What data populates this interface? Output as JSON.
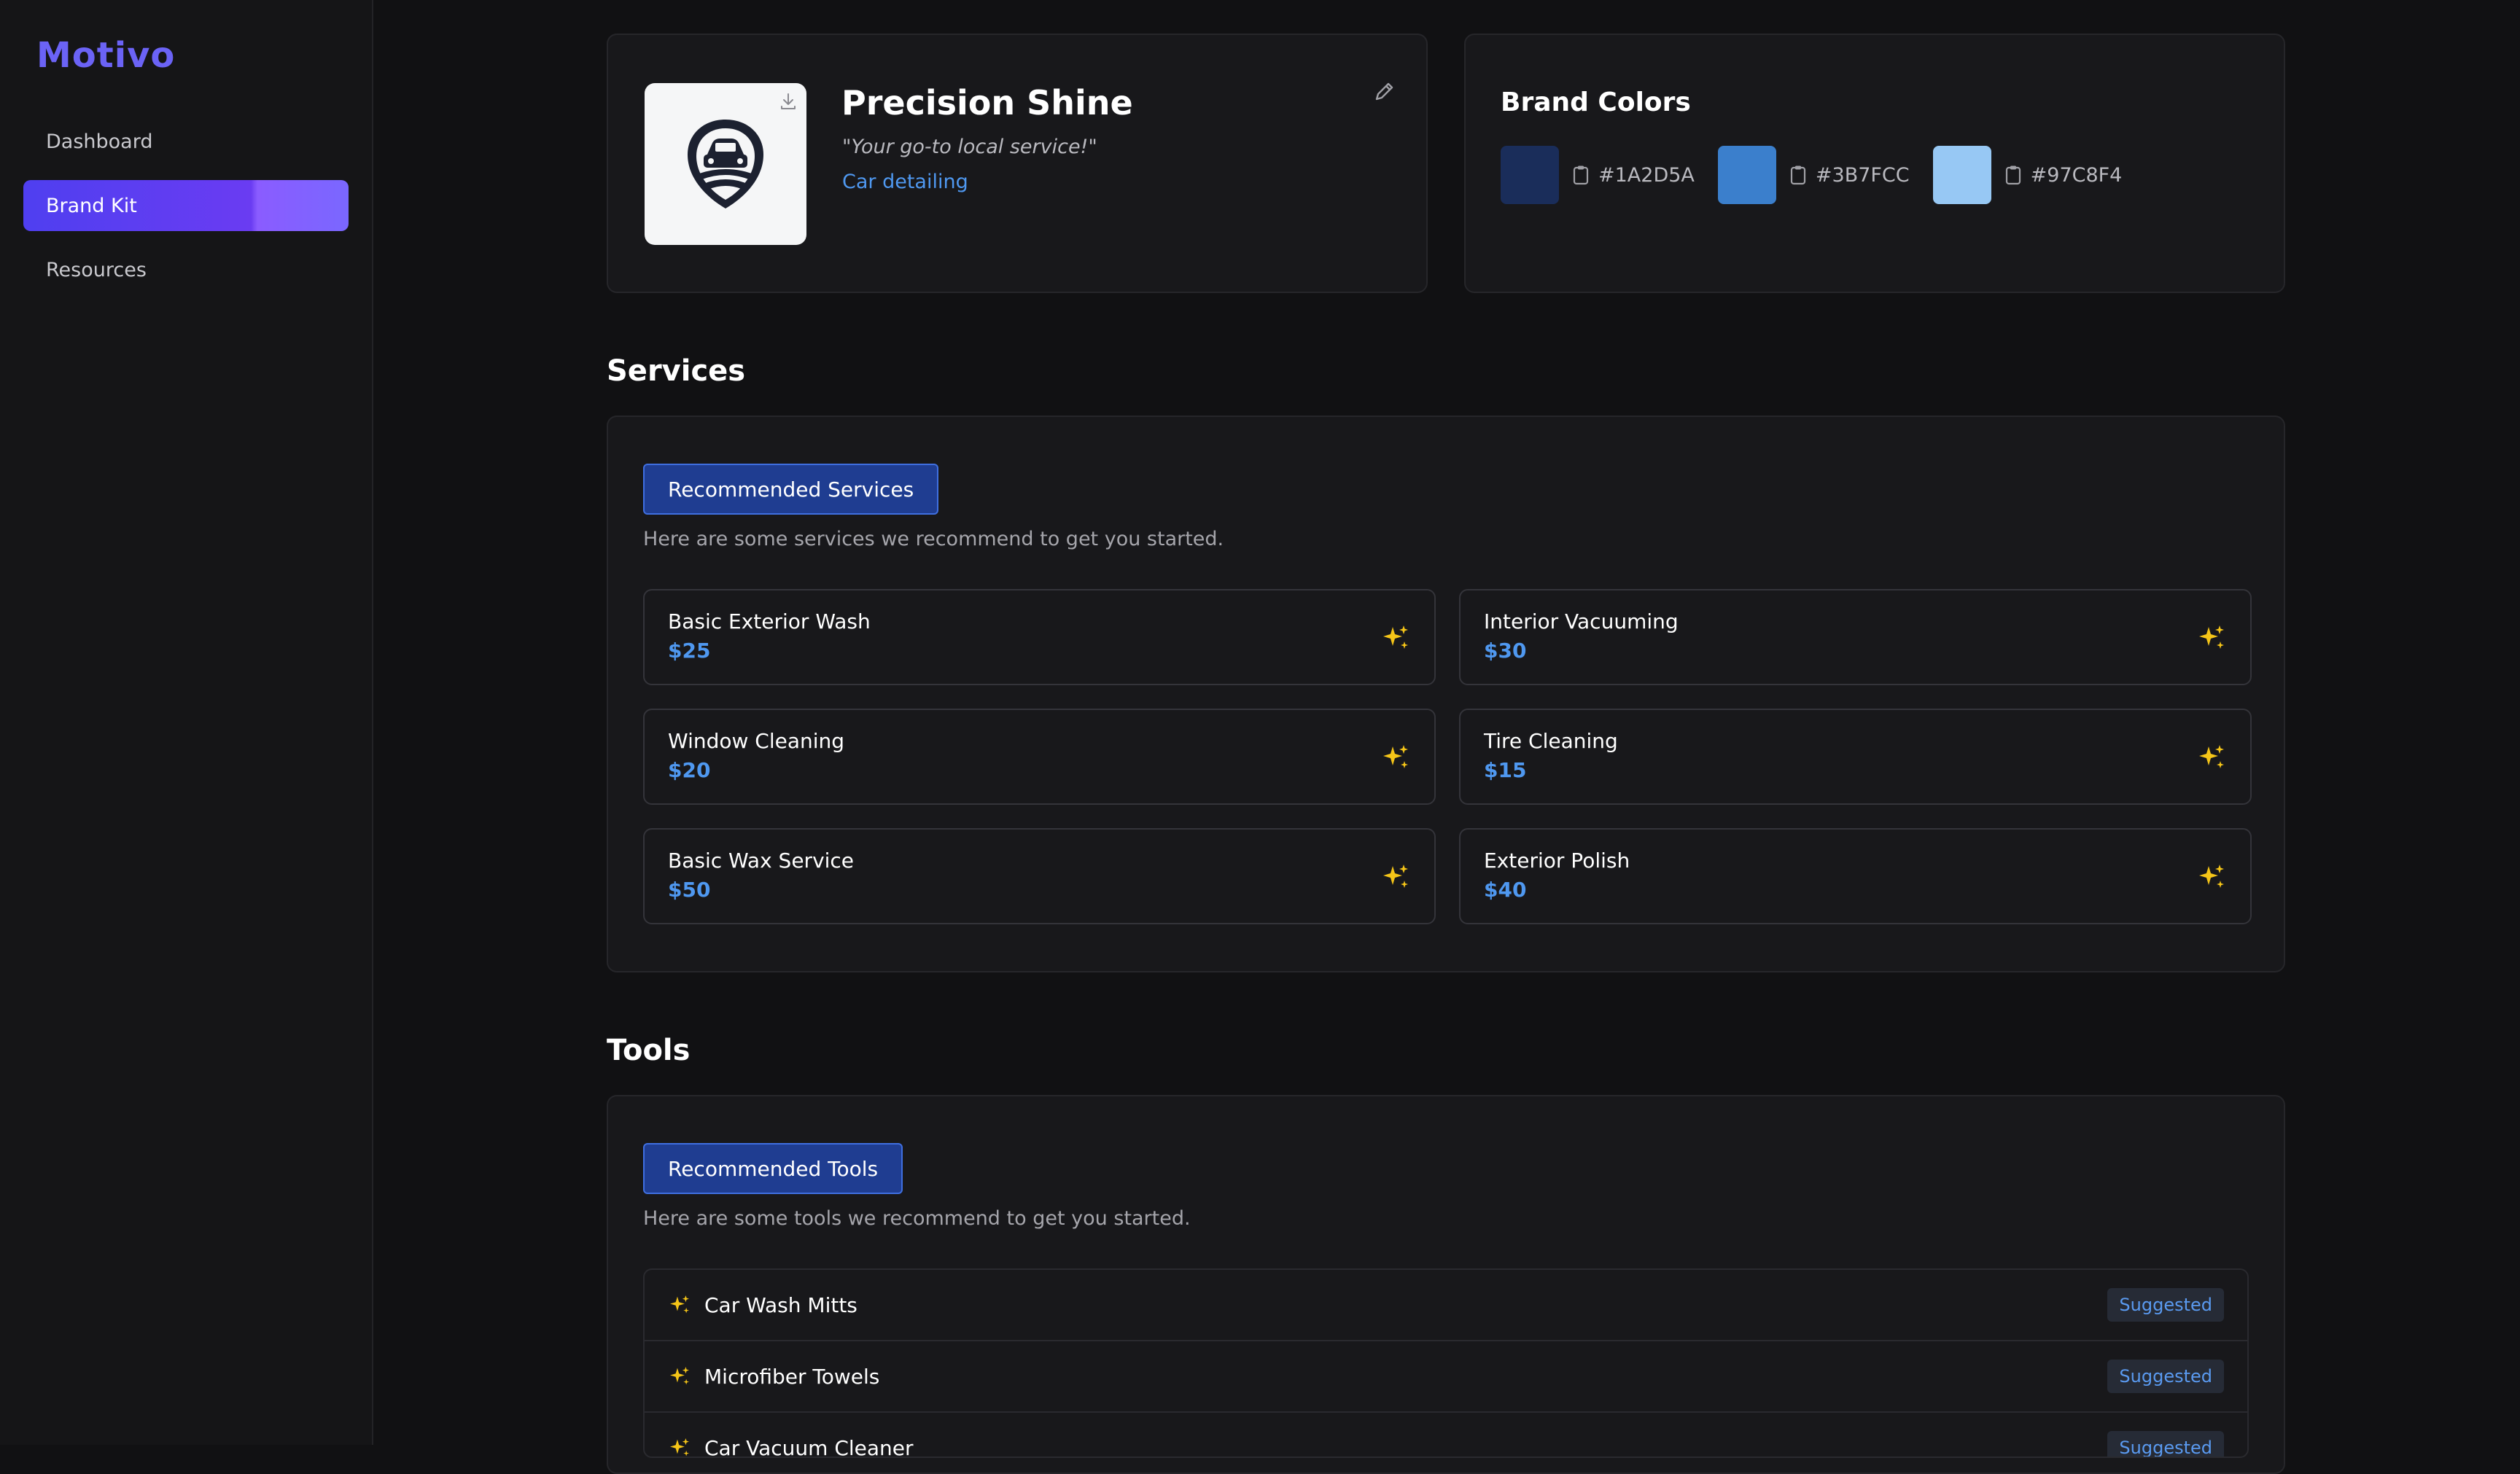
{
  "app": {
    "name": "Motivo"
  },
  "sidebar": {
    "items": [
      {
        "label": "Dashboard"
      },
      {
        "label": "Brand Kit",
        "active": true
      },
      {
        "label": "Resources"
      }
    ]
  },
  "brand": {
    "name": "Precision Shine",
    "tagline": "\"Your go-to local service!\"",
    "category": "Car detailing",
    "logo_icon": "car-shield-logo",
    "download_icon": "download-icon",
    "edit_icon": "pencil-icon"
  },
  "brand_colors": {
    "title": "Brand Colors",
    "colors": [
      {
        "hex": "#1A2D5A",
        "label": "#1A2D5A"
      },
      {
        "hex": "#3B7FCC",
        "label": "#3B7FCC"
      },
      {
        "hex": "#97C8F4",
        "label": "#97C8F4"
      }
    ]
  },
  "services": {
    "title": "Services",
    "pill": "Recommended Services",
    "subtitle": "Here are some services we recommend to get you started.",
    "items": [
      {
        "name": "Basic Exterior Wash",
        "price": "$25"
      },
      {
        "name": "Interior Vacuuming",
        "price": "$30"
      },
      {
        "name": "Window Cleaning",
        "price": "$20"
      },
      {
        "name": "Tire Cleaning",
        "price": "$15"
      },
      {
        "name": "Basic Wax Service",
        "price": "$50"
      },
      {
        "name": "Exterior Polish",
        "price": "$40"
      }
    ]
  },
  "tools": {
    "title": "Tools",
    "pill": "Recommended Tools",
    "subtitle": "Here are some tools we recommend to get you started.",
    "items": [
      {
        "name": "Car Wash Mitts",
        "badge": "Suggested"
      },
      {
        "name": "Microfiber Towels",
        "badge": "Suggested"
      },
      {
        "name": "Car Vacuum Cleaner",
        "badge": "Suggested"
      }
    ]
  },
  "colors": {
    "accent": "#6b63f6",
    "sparkle": "#f5c518",
    "price": "#4f98f0",
    "pill_bg": "#1f3d91"
  }
}
